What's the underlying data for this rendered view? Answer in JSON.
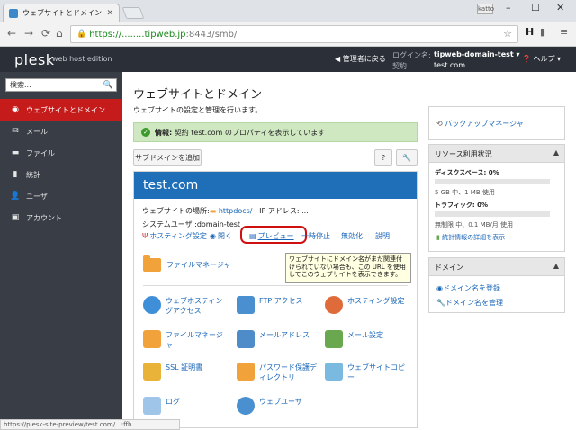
{
  "browser": {
    "tab_title": "ウェブサイトとドメイン - Plesk",
    "user_badge": "katto",
    "url_host": "https://........tipweb.jp",
    "url_rest": ":8443/smb/",
    "status_url": "https://plesk-site-preview/test.com/...:ffb..."
  },
  "header": {
    "logo": "plesk",
    "edition": "web host edition",
    "back_to_admin": "管理者に戻る",
    "login_label": "ログイン名:",
    "login_value": "tipweb-domain-test ▾",
    "contract_label": "契約",
    "contract_value": "test.com",
    "help": "ヘルプ ▾"
  },
  "sidebar": {
    "search_placeholder": "検索...",
    "items": [
      {
        "label": "ウェブサイトとドメイン"
      },
      {
        "label": "メール"
      },
      {
        "label": "ファイル"
      },
      {
        "label": "統計"
      },
      {
        "label": "ユーザ"
      },
      {
        "label": "アカウント"
      }
    ]
  },
  "main": {
    "title": "ウェブサイトとドメイン",
    "subtitle": "ウェブサイトの設定と管理を行います。",
    "info_bold": "情報:",
    "info_text": "契約 test.com のプロパティを表示しています",
    "add_subdomain": "サブドメインを追加",
    "help_btn": "?"
  },
  "card": {
    "domain": "test.com",
    "location_label": "ウェブサイトの場所:",
    "location_link": "httpdocs/",
    "ip_label": "IP アドレス: ",
    "ip_value": "...",
    "sysuser": "システムユーザ :domain-test",
    "actions": [
      "ホスティング設定",
      "開く",
      "プレビュー",
      "一時停止",
      "無効化",
      "説明"
    ],
    "tooltip": "ウェブサイトにドメイン名がまだ関連付けられていない場合も、この URL を使用してこのウェブサイトを表示できます。",
    "file_manager": "ファイルマネージャ",
    "tools": [
      "ウェブホスティングアクセス",
      "FTP アクセス",
      "ホスティング設定",
      "ファイルマネージャ",
      "メールアドレス",
      "メール設定",
      "SSL 証明書",
      "パスワード保護ディレクトリ",
      "ウェブサイトコピー",
      "ログ",
      "ウェブユーザ"
    ]
  },
  "right": {
    "backup": "バックアップマネージャ",
    "resources_title": "リソース利用状況",
    "disk_label": "ディスクスペース: 0%",
    "disk_detail": "5 GB 中、1 MB 使用",
    "traffic_label": "トラフィック: 0%",
    "traffic_detail": "無制限 中、0.1 MB/月 使用",
    "stats_link": "統計情報の詳細を表示",
    "domains_title": "ドメイン",
    "reg_domain": "ドメイン名を登録",
    "manage_domain": "ドメイン名を管理"
  }
}
